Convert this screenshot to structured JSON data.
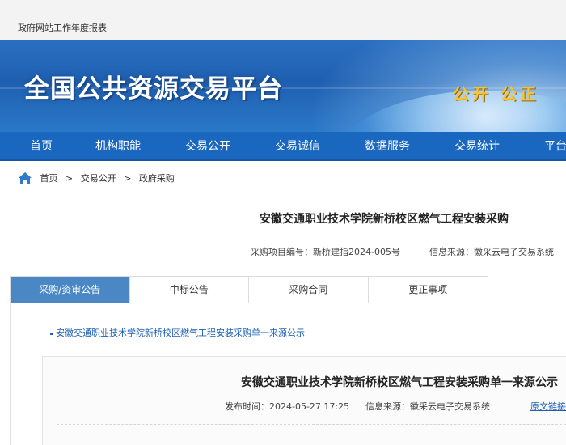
{
  "topbar": {
    "link": "政府网站工作年度报表"
  },
  "header": {
    "title": "全国公共资源交易平台",
    "slogan": "公开 公正"
  },
  "nav": {
    "items": [
      "首页",
      "机构职能",
      "交易公开",
      "交易诚信",
      "数据服务",
      "交易统计",
      "平台"
    ]
  },
  "breadcrumb": {
    "home": "首页",
    "sep": ">",
    "level2": "交易公开",
    "level3": "政府采购"
  },
  "document": {
    "title": "安徽交通职业技术学院新桥校区燃气工程安装采购",
    "project_no": "采购项目编号：新桥建指2024-005号",
    "source": "信息来源：徽采云电子交易系统"
  },
  "tabs": [
    {
      "label": "采购/资审公告",
      "active": true
    },
    {
      "label": "中标公告",
      "active": false
    },
    {
      "label": "采购合同",
      "active": false
    },
    {
      "label": "更正事项",
      "active": false
    }
  ],
  "notice": {
    "link": "安徽交通职业技术学院新桥校区燃气工程安装采购单一来源公示"
  },
  "detail": {
    "title": "安徽交通职业技术学院新桥校区燃气工程安装采购单一来源公示",
    "publish_time": "发布时间：2024-05-27 17:25",
    "source": "信息来源：徽采云电子交易系统",
    "origin_link": "原文链接"
  },
  "colors": {
    "nav_bg": "#1a67c0",
    "tab_active": "#4a88c5",
    "link": "#1a5fb4",
    "slogan": "#f6c431"
  }
}
